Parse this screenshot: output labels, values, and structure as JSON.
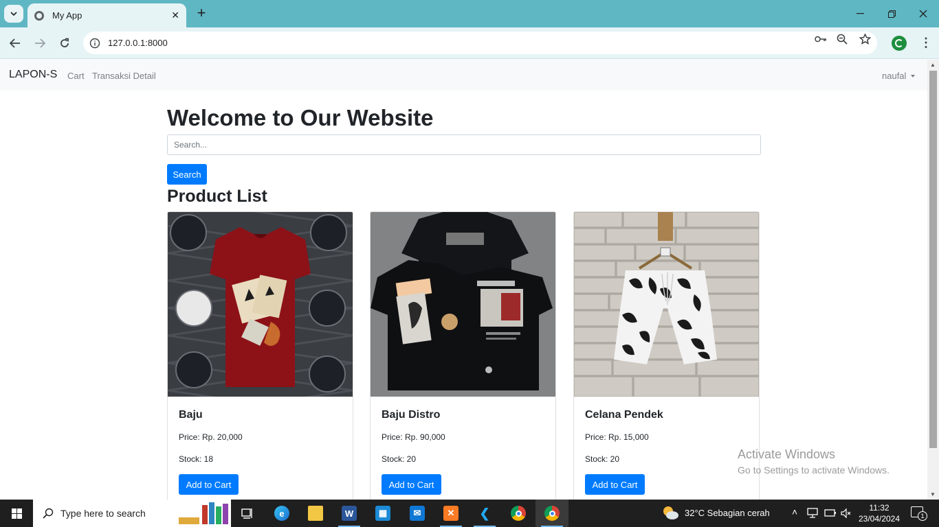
{
  "browser": {
    "tab_title": "My App",
    "url": "127.0.0.1:8000"
  },
  "navbar": {
    "brand": "LAPON-S",
    "links": [
      "Cart",
      "Transaksi Detail"
    ],
    "user": "naufal"
  },
  "main": {
    "heading": "Welcome to Our Website",
    "search_placeholder": "Search...",
    "search_button": "Search",
    "product_heading": "Product List"
  },
  "products": [
    {
      "name": "Baju",
      "price": "Price: Rp. 20,000",
      "stock": "Stock: 18",
      "button": "Add to Cart",
      "image": "red-tshirt-photo"
    },
    {
      "name": "Baju Distro",
      "price": "Price: Rp. 90,000",
      "stock": "Stock: 20",
      "button": "Add to Cart",
      "image": "black-tshirt-photo"
    },
    {
      "name": "Celana Pendek",
      "price": "Price: Rp. 15,000",
      "stock": "Stock: 20",
      "button": "Add to Cart",
      "image": "floral-shorts-photo"
    }
  ],
  "watermark": {
    "title": "Activate Windows",
    "subtitle": "Go to Settings to activate Windows."
  },
  "taskbar": {
    "search_placeholder": "Type here to search",
    "weather": "32°C  Sebagian cerah",
    "time": "11:32",
    "date": "23/04/2024",
    "notification_count": "1"
  },
  "colors": {
    "primary": "#007bff",
    "tabstrip": "#5fb7c3",
    "toolbar": "#e6f4f6"
  }
}
